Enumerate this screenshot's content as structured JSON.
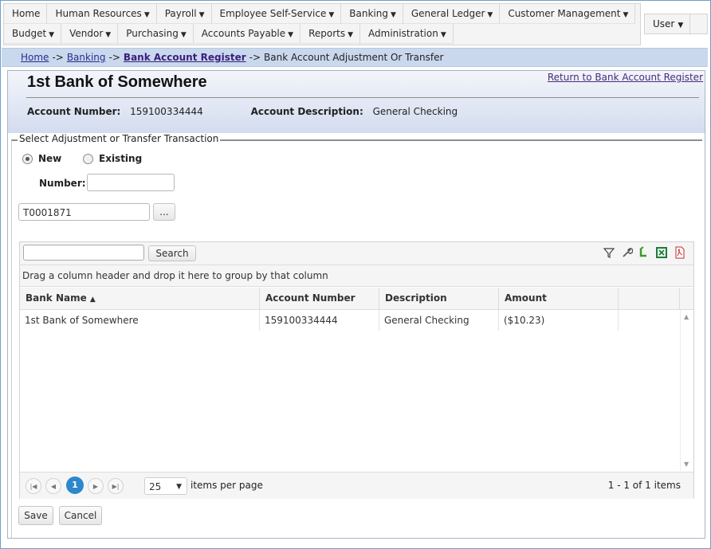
{
  "menu": {
    "row1": [
      {
        "label": "Home",
        "caret": ""
      },
      {
        "label": "Human Resources",
        "caret": "▼"
      },
      {
        "label": "Payroll",
        "caret": "▼"
      },
      {
        "label": "Employee Self-Service",
        "caret": "▼"
      },
      {
        "label": "Banking",
        "caret": "▼"
      },
      {
        "label": "General Ledger",
        "caret": "▼"
      },
      {
        "label": "Customer Management",
        "caret": "▼"
      }
    ],
    "row2": [
      {
        "label": "Budget",
        "caret": "▼"
      },
      {
        "label": "Vendor",
        "caret": "▼"
      },
      {
        "label": "Purchasing",
        "caret": "▼"
      },
      {
        "label": "Accounts Payable",
        "caret": "▼"
      },
      {
        "label": "Reports",
        "caret": "▼"
      },
      {
        "label": "Administration",
        "caret": "▼"
      }
    ],
    "user": {
      "label": "User",
      "caret": "▼"
    }
  },
  "breadcrumb": {
    "home": "Home",
    "banking": "Banking",
    "register": "Bank Account Register",
    "current": "Bank Account Adjustment Or Transfer",
    "separator": "->"
  },
  "header": {
    "title": "1st Bank of Somewhere",
    "return_link": "Return to Bank Account Register",
    "account_number_label": "Account Number:",
    "account_number": "159100334444",
    "account_description_label": "Account Description:",
    "account_description": "General Checking"
  },
  "form": {
    "legend": "Select Adjustment or Transfer Transaction",
    "radio_new": "New",
    "radio_existing": "Existing",
    "selected": "New",
    "number_label": "Number:",
    "number_value": "",
    "transaction_value": "T0001871",
    "lookup_button": "...",
    "save_button": "Save",
    "cancel_button": "Cancel"
  },
  "grid": {
    "search_value": "",
    "search_button": "Search",
    "group_hint": "Drag a column header and drop it here to group by that column",
    "columns": [
      "Bank Name",
      "Account Number",
      "Description",
      "Amount"
    ],
    "sort_indicator": "▲",
    "rows": [
      [
        "1st Bank of Somewhere",
        "159100334444",
        "General Checking",
        "($10.23)"
      ]
    ],
    "pager": {
      "current_page": "1",
      "page_size": "25",
      "page_size_label": "items per page",
      "summary": "1 - 1 of 1 items"
    },
    "toolbar_icons": [
      "filter-icon",
      "wrench-icon",
      "refresh-icon",
      "excel-icon",
      "pdf-icon"
    ]
  }
}
